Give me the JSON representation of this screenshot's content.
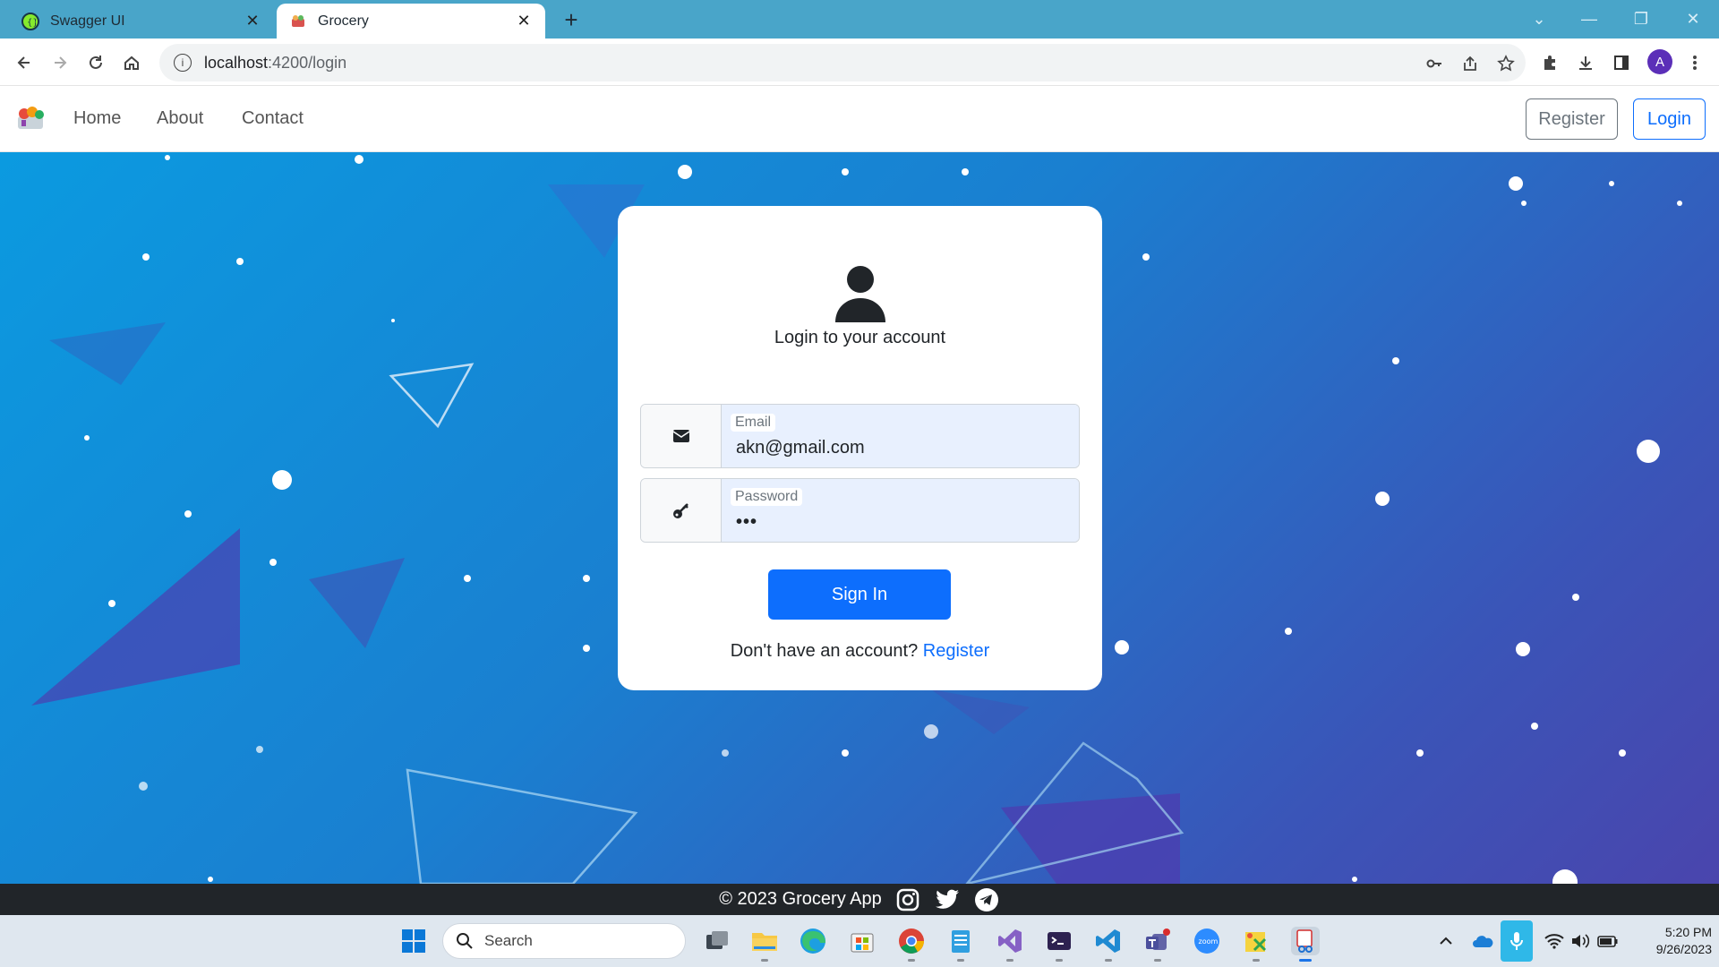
{
  "browser": {
    "tabs": [
      {
        "title": "Swagger UI",
        "active": false,
        "icon": "swagger-icon"
      },
      {
        "title": "Grocery",
        "active": true,
        "icon": "grocery-favicon"
      }
    ],
    "url_host": "localhost",
    "url_path": ":4200/login",
    "profile_initial": "A"
  },
  "navbar": {
    "links": [
      "Home",
      "About",
      "Contact"
    ],
    "register_label": "Register",
    "login_label": "Login"
  },
  "login": {
    "title": "Login to your account",
    "email_label": "Email",
    "email_value": "akn@gmail.com",
    "password_label": "Password",
    "password_value": "•••",
    "submit_label": "Sign In",
    "no_account_text": "Don't have an account?",
    "register_link": "Register"
  },
  "footer": {
    "copyright": "© 2023 Grocery App",
    "social": [
      "instagram-icon",
      "twitter-icon",
      "telegram-icon"
    ]
  },
  "taskbar": {
    "search_placeholder": "Search",
    "time": "5:20 PM",
    "date": "9/26/2023"
  },
  "colors": {
    "primary": "#0d6efd",
    "secondary": "#6c757d",
    "tabbar": "#49a5c9",
    "footer": "#212529",
    "hero_start": "#0b9ae0",
    "hero_end": "#4a45ad"
  }
}
